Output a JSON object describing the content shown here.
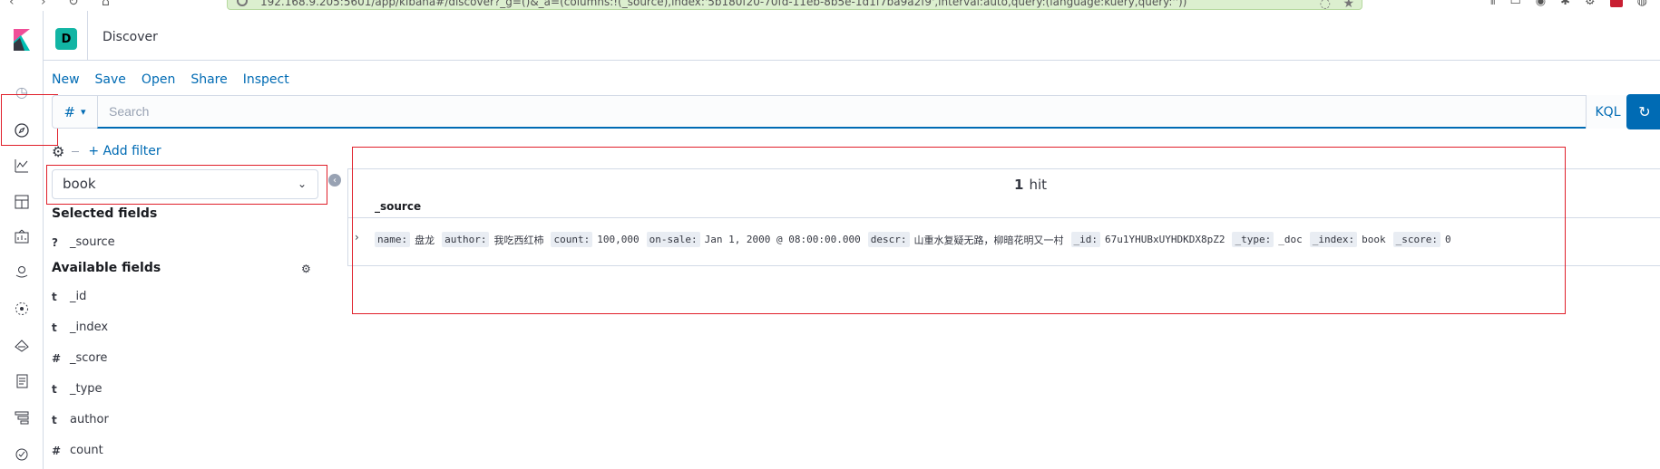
{
  "browser": {
    "url": "192.168.9.205:5601/app/kibana#/discover?_g=()&_a=(columns:!(_source),index:'5b180f20-70fd-11eb-8b5e-1d1f7ba9a2f9',interval:auto,query:(language:kuery,query:''))"
  },
  "header": {
    "space_initial": "D",
    "breadcrumb": "Discover"
  },
  "top_menu": [
    "New",
    "Save",
    "Open",
    "Share",
    "Inspect"
  ],
  "query": {
    "type_symbol": "#",
    "placeholder": "Search",
    "language": "KQL"
  },
  "filters": {
    "add_label": "+ Add filter"
  },
  "index_pattern": {
    "selected": "book"
  },
  "fields": {
    "selected_title": "Selected fields",
    "selected": [
      {
        "type": "?",
        "name": "_source"
      }
    ],
    "available_title": "Available fields",
    "available": [
      {
        "type": "t",
        "name": "_id"
      },
      {
        "type": "t",
        "name": "_index"
      },
      {
        "type": "#",
        "name": "_score"
      },
      {
        "type": "t",
        "name": "_type"
      },
      {
        "type": "t",
        "name": "author"
      },
      {
        "type": "#",
        "name": "count"
      }
    ]
  },
  "results": {
    "hit_count": "1",
    "hit_label": "hit",
    "column": "_source",
    "doc": [
      {
        "key": "name:",
        "value": "盘龙"
      },
      {
        "key": "author:",
        "value": "我吃西红柿"
      },
      {
        "key": "count:",
        "value": "100,000"
      },
      {
        "key": "on-sale:",
        "value": "Jan 1, 2000 @ 08:00:00.000"
      },
      {
        "key": "descr:",
        "value": "山重水复疑无路，柳暗花明又一村"
      },
      {
        "key": "_id:",
        "value": "67u1YHUBxUYHDKDX8pZ2"
      },
      {
        "key": "_type:",
        "value": "_doc"
      },
      {
        "key": "_index:",
        "value": "book"
      },
      {
        "key": "_score:",
        "value": "0"
      }
    ]
  },
  "colors": {
    "accent": "#006bb4",
    "highlight_box": "#e01f2a",
    "space_avatar": "#12b5a4"
  }
}
